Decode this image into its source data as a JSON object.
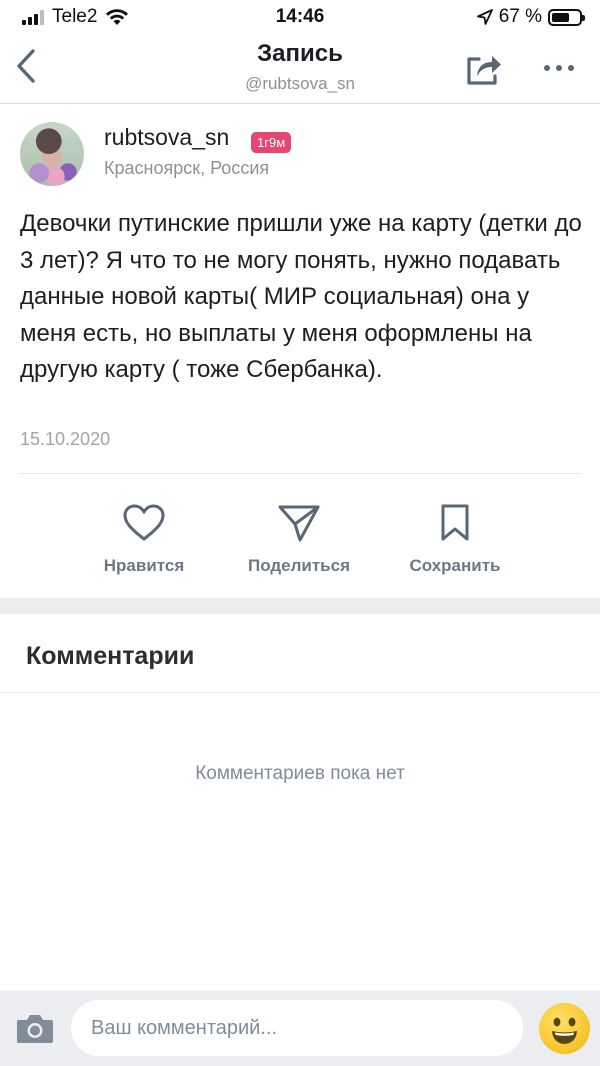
{
  "status_bar": {
    "carrier": "Tele2",
    "time": "14:46",
    "battery_percent": "67 %",
    "battery_level": 0.67
  },
  "nav": {
    "title": "Запись",
    "subtitle": "@rubtsova_sn",
    "back_icon": "chevron-left-icon",
    "share_icon": "share-arrow-icon",
    "more_icon": "more-dots-icon"
  },
  "post": {
    "author": "rubtsova_sn",
    "badge": "1г9м",
    "location": "Красноярск, Россия",
    "text": "Девочки путинские пришли уже на карту (детки до 3 лет)? Я что то не могу понять, нужно подавать данные новой карты( МИР социальная) она у меня есть, но выплаты у меня оформлены на другую карту ( тоже Сбербанка).",
    "date": "15.10.2020"
  },
  "actions": {
    "like_label": "Нравится",
    "share_label": "Поделиться",
    "save_label": "Сохранить"
  },
  "comments": {
    "title": "Комментарии",
    "empty_text": "Комментариев пока нет"
  },
  "composer": {
    "placeholder": "Ваш комментарий...",
    "value": ""
  },
  "colors": {
    "accent_badge": "#e64672",
    "icon": "#5a6675",
    "secondary_text": "#8c9196",
    "emoji": "#f7c428"
  }
}
